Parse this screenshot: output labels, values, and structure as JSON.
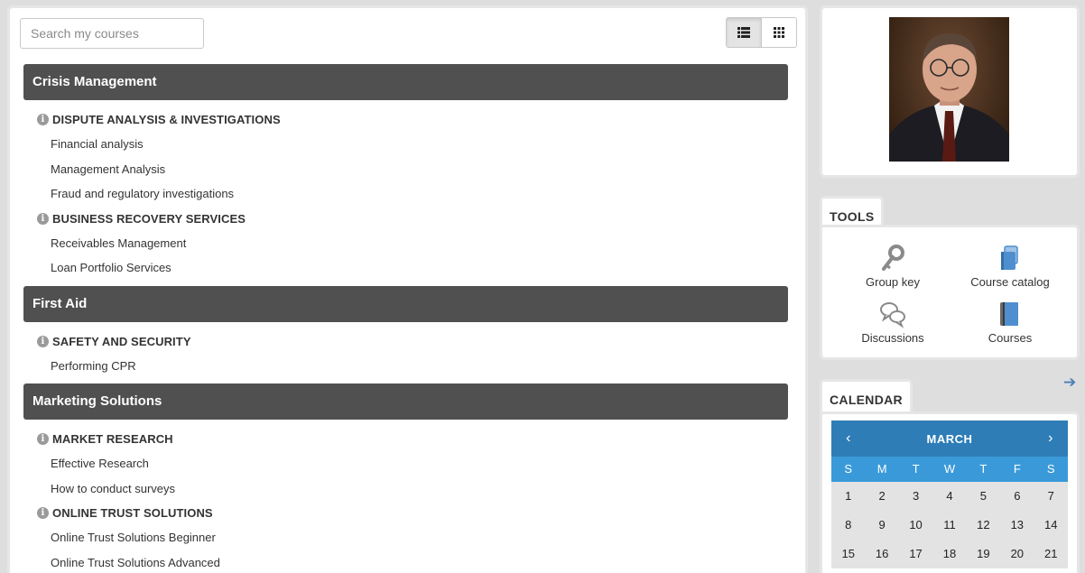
{
  "search": {
    "placeholder": "Search my courses"
  },
  "view_toggle": {
    "list_icon": "list-view-icon",
    "grid_icon": "grid-view-icon",
    "active": "list"
  },
  "categories": [
    {
      "title": "Crisis Management",
      "groups": [
        {
          "title": "DISPUTE ANALYSIS & INVESTIGATIONS",
          "courses": [
            "Financial analysis",
            "Management Analysis",
            "Fraud and regulatory investigations"
          ]
        },
        {
          "title": "BUSINESS RECOVERY SERVICES",
          "courses": [
            "Receivables Management",
            "Loan Portfolio Services"
          ]
        }
      ]
    },
    {
      "title": "First Aid",
      "groups": [
        {
          "title": "SAFETY AND SECURITY",
          "courses": [
            "Performing CPR"
          ]
        }
      ]
    },
    {
      "title": "Marketing Solutions",
      "groups": [
        {
          "title": "MARKET RESEARCH",
          "courses": [
            "Effective Research",
            "How to conduct surveys"
          ]
        },
        {
          "title": "ONLINE TRUST SOLUTIONS",
          "courses": [
            "Online Trust Solutions Beginner",
            "Online Trust Solutions Advanced"
          ]
        }
      ]
    }
  ],
  "tools": {
    "title": "TOOLS",
    "items": [
      {
        "label": "Group key",
        "icon": "key-icon"
      },
      {
        "label": "Course catalog",
        "icon": "catalog-icon"
      },
      {
        "label": "Discussions",
        "icon": "discussions-icon"
      },
      {
        "label": "Courses",
        "icon": "courses-icon"
      }
    ]
  },
  "calendar": {
    "title": "CALENDAR",
    "month": "MARCH",
    "prev": "‹",
    "next": "›",
    "arrow": "➔",
    "weekdays": [
      "S",
      "M",
      "T",
      "W",
      "T",
      "F",
      "S"
    ],
    "weeks": [
      [
        "1",
        "2",
        "3",
        "4",
        "5",
        "6",
        "7"
      ],
      [
        "8",
        "9",
        "10",
        "11",
        "12",
        "13",
        "14"
      ],
      [
        "15",
        "16",
        "17",
        "18",
        "19",
        "20",
        "21"
      ]
    ]
  },
  "colors": {
    "category_header": "#505050",
    "calendar_header": "#2e7db7",
    "calendar_weekdays": "#3a9ad9",
    "tool_icon_blue": "#4f8fcf"
  }
}
